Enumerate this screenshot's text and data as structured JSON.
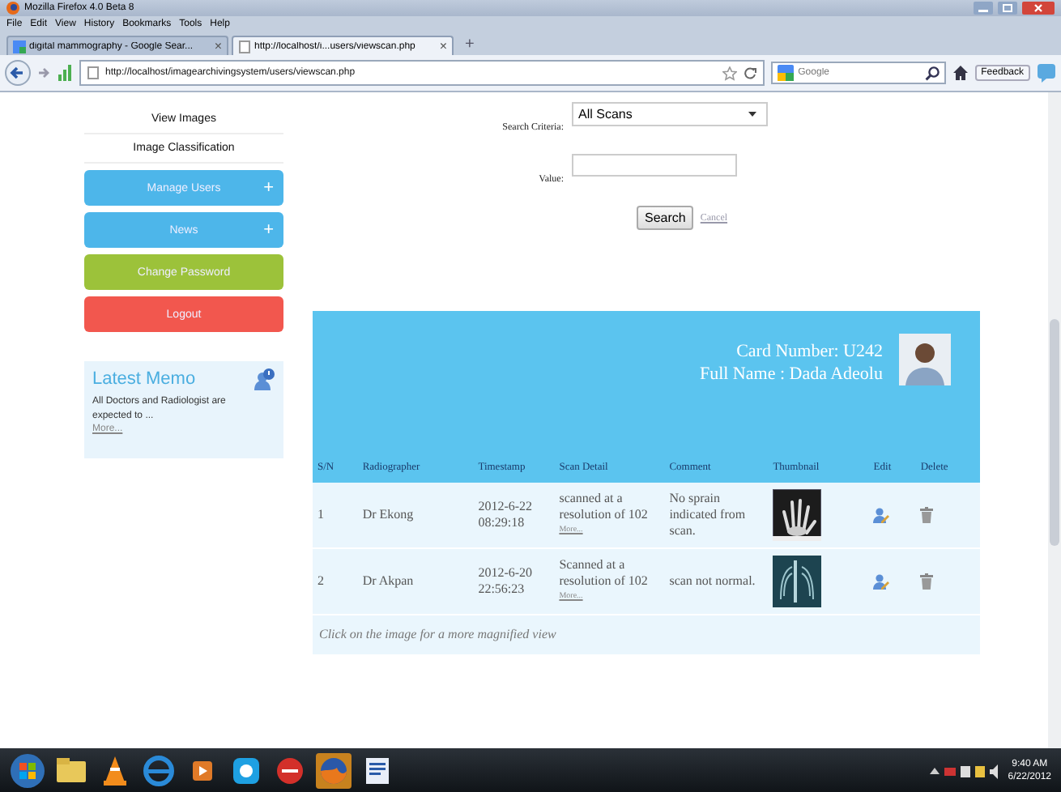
{
  "browser": {
    "title": "Mozilla Firefox 4.0 Beta 8",
    "menu": [
      "File",
      "Edit",
      "View",
      "History",
      "Bookmarks",
      "Tools",
      "Help"
    ],
    "tabs": [
      {
        "label": "digital mammography - Google Sear...",
        "selected": false,
        "close": "×"
      },
      {
        "label": "http://localhost/i...users/viewscan.php",
        "selected": true,
        "close": "×"
      }
    ],
    "new_tab": "+",
    "address": "http://localhost/imagearchivingsystem/users/viewscan.php",
    "search_placeholder": "Google",
    "feedback": "Feedback"
  },
  "sidebar": {
    "links": [
      "View Images",
      "Image Classification"
    ],
    "buttons": [
      {
        "label": "Manage Users",
        "icon": "+",
        "color": "#4db6ea"
      },
      {
        "label": "News",
        "icon": "+",
        "color": "#4db6ea"
      },
      {
        "label": "Change Password",
        "color": "#9cc23a"
      },
      {
        "label": "Logout",
        "color": "#f2574e"
      }
    ],
    "memo": {
      "title": "Latest Memo",
      "text": "All Doctors and Radiologist are expected to ...",
      "link": "More..."
    }
  },
  "search": {
    "criteria_label": "Search Criteria:",
    "criteria_value": "All Scans",
    "value_label": "Value:",
    "button": "Search",
    "cancel": "Cancel"
  },
  "card": {
    "card_number": "Card Number: U242",
    "full_name": "Full Name : Dada Adeolu",
    "columns": [
      "S/N",
      "Radiographer",
      "Timestamp",
      "Scan Detail",
      "Comment",
      "Thumbnail",
      "Edit",
      "Delete"
    ],
    "rows": [
      {
        "sn": "1",
        "radiographer": "Dr Ekong",
        "timestamp": "2012-6-22 08:29:18",
        "scan_detail": "scanned at a resolution of 102",
        "more": "More...",
        "comment": "No sprain indicated from scan.",
        "thumbnail": {
          "kind": "hand"
        }
      },
      {
        "sn": "2",
        "radiographer": "Dr Akpan",
        "timestamp": "2012-6-20 22:56:23",
        "scan_detail": "Scanned at a resolution of 102",
        "more": "More...",
        "comment": "scan not normal.",
        "thumbnail": {
          "kind": "chest"
        }
      }
    ],
    "note": "Click on the image for a more magnified view"
  },
  "taskbar": {
    "time": "9:40 AM",
    "date": "6/22/2012"
  }
}
